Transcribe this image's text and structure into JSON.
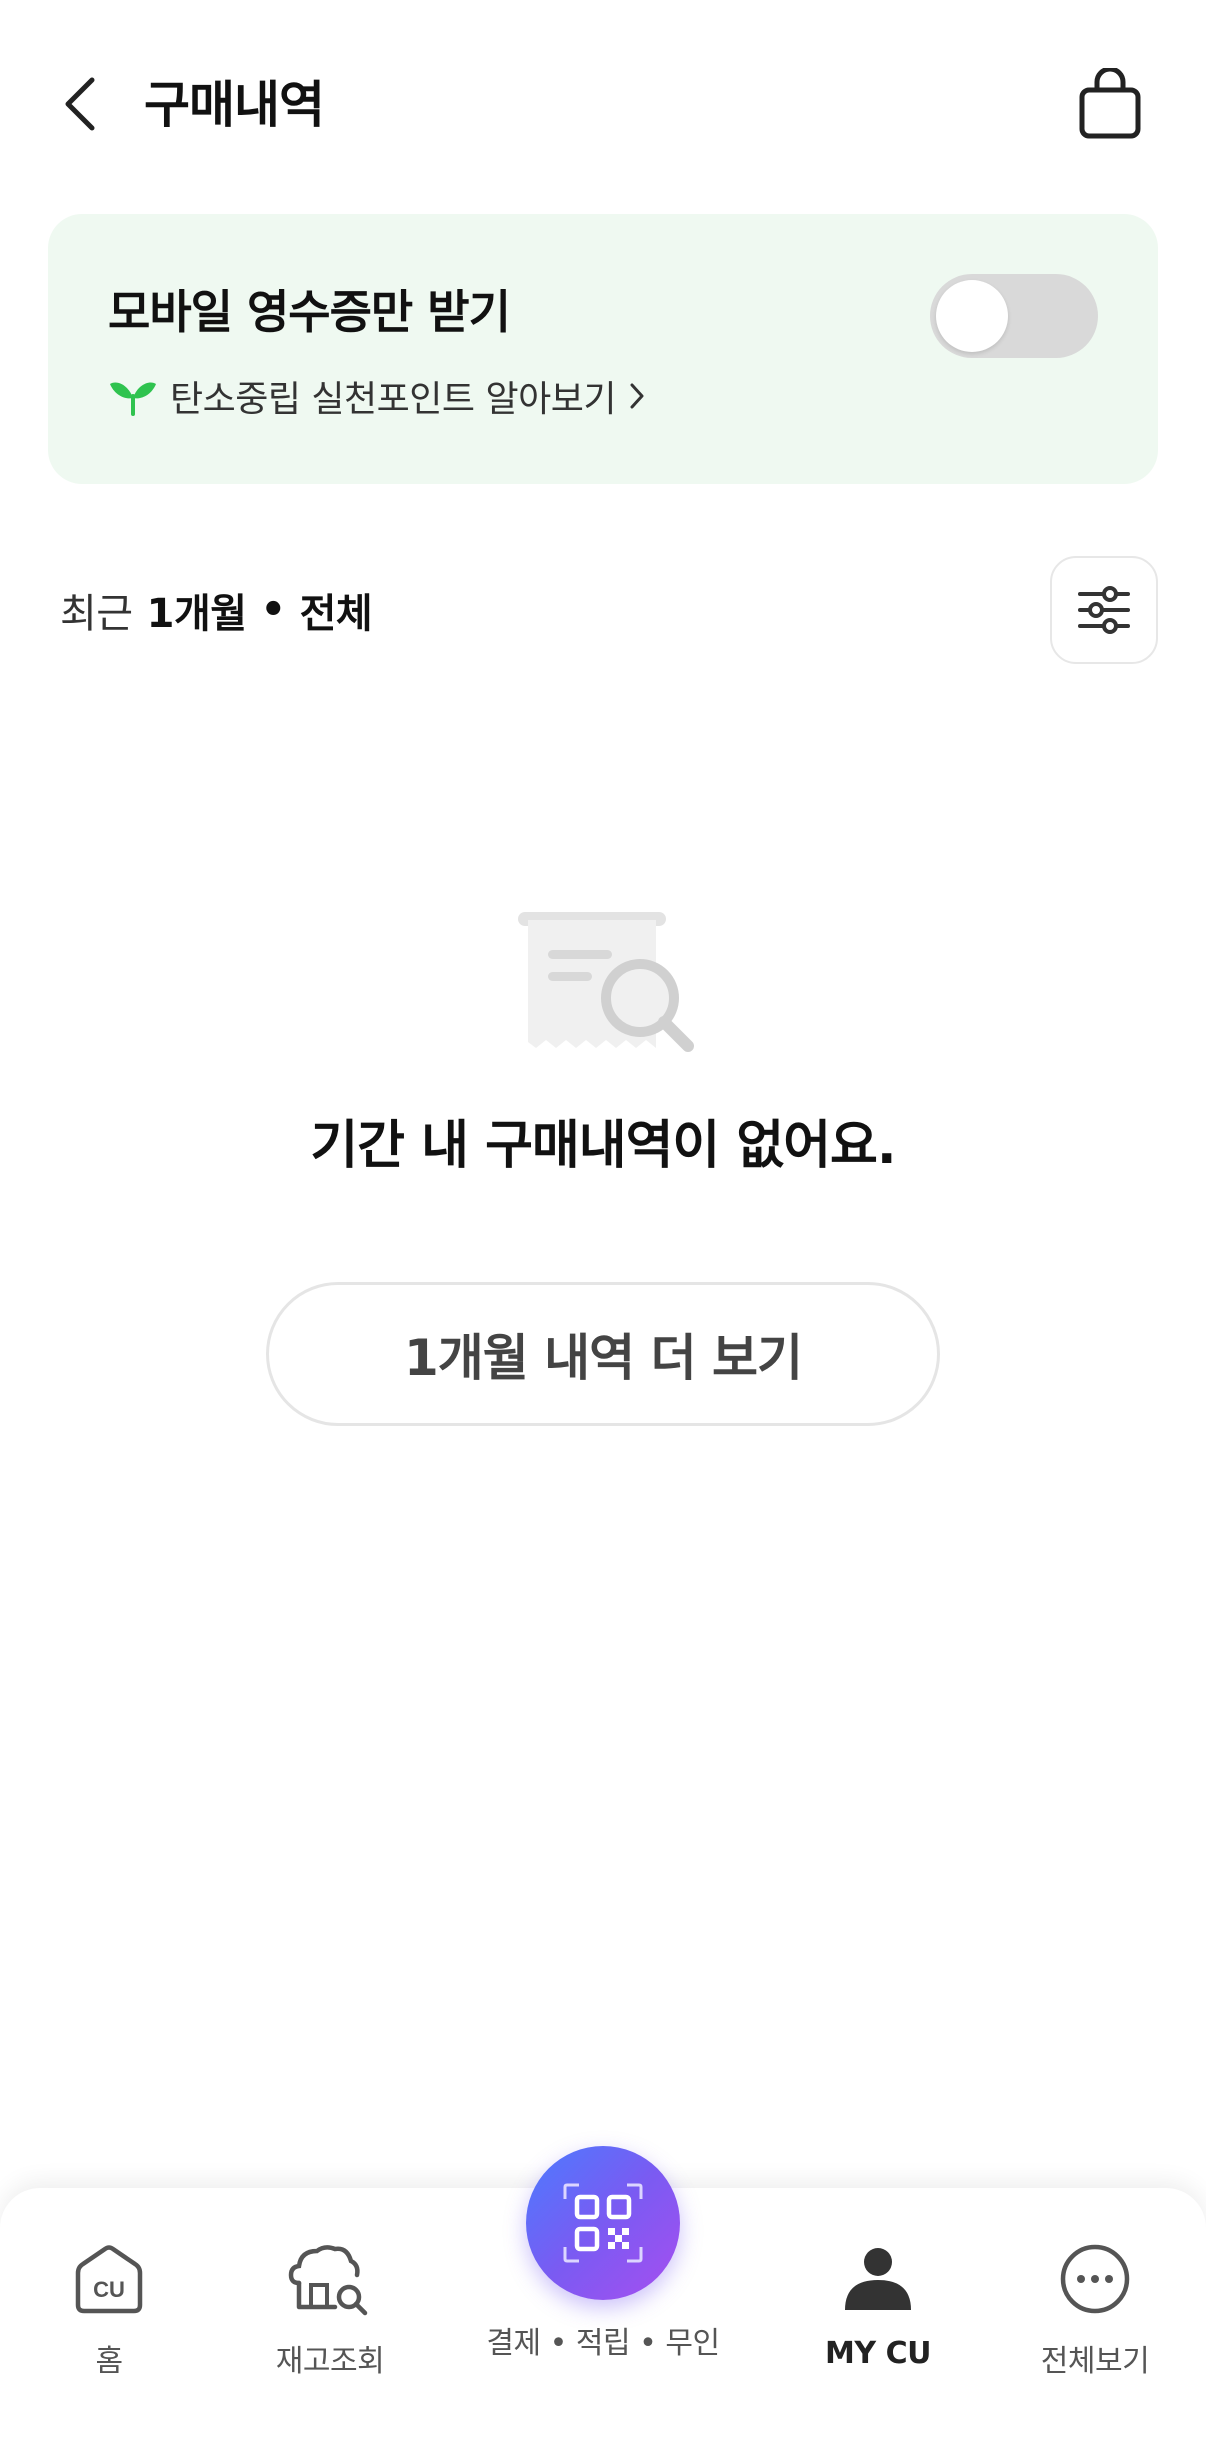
{
  "header": {
    "title": "구매내역",
    "back_icon": "chevron-left-icon",
    "bag_icon": "shopping-bag-icon"
  },
  "receipt_card": {
    "title": "모바일 영수증만 받기",
    "link_label": "탄소중립 실천포인트 알아보기",
    "toggle_on": false,
    "background_color": "#eff9f1",
    "leaf_color": "#2fc34f"
  },
  "filter": {
    "recent_label": "최근",
    "period": "1개월",
    "separator": "•",
    "scope": "전체",
    "icon": "sliders-icon"
  },
  "empty_state": {
    "message": "기간 내 구매내역이 없어요.",
    "icon": "receipt-search-icon",
    "more_button_label": "1개월 내역 더 보기"
  },
  "bottom_nav": {
    "items": [
      {
        "label": "홈",
        "icon": "home-cu-icon",
        "active": false
      },
      {
        "label": "재고조회",
        "icon": "stock-search-icon",
        "active": false
      },
      {
        "label": "결제 • 적립 • 무인",
        "icon": "qr-code-icon",
        "active": false
      },
      {
        "label": "MY CU",
        "icon": "user-icon",
        "active": true
      },
      {
        "label": "전체보기",
        "icon": "more-dots-icon",
        "active": false
      }
    ],
    "home_logo_text": "CU",
    "fab_gradient": [
      "#4b7bff",
      "#a74ef0"
    ]
  }
}
